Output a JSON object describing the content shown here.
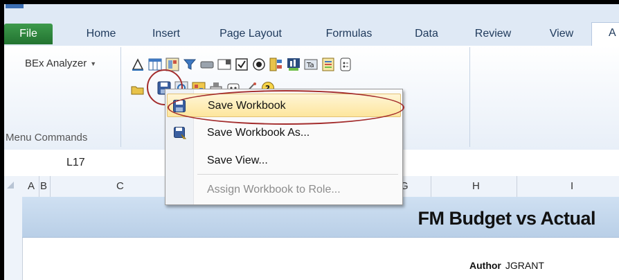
{
  "tabs": [
    "File",
    "Home",
    "Insert",
    "Page Layout",
    "Formulas",
    "Data",
    "Review",
    "View",
    "A"
  ],
  "ribbon": {
    "bex_label": "BEx Analyzer",
    "group_label": "Menu Commands"
  },
  "formula_bar": {
    "cell_ref": "L17"
  },
  "columns": [
    "A",
    "B",
    "C",
    "G",
    "H",
    "I"
  ],
  "sheet": {
    "title": "FM Budget vs Actual",
    "author_label": "Author",
    "author_value": "JGRANT"
  },
  "context_menu": {
    "items": [
      {
        "label": "Save Workbook",
        "enabled": true,
        "icon": "save-icon"
      },
      {
        "label": "Save Workbook As...",
        "enabled": true,
        "icon": "save-as-icon"
      },
      {
        "label": "Save View...",
        "enabled": true,
        "icon": ""
      },
      {
        "label": "Assign Workbook to Role...",
        "enabled": false,
        "icon": ""
      }
    ]
  },
  "colors": {
    "file_tab": "#2a7f3a",
    "highlight_ring": "#a32c2c",
    "hover": "#fde69d"
  }
}
